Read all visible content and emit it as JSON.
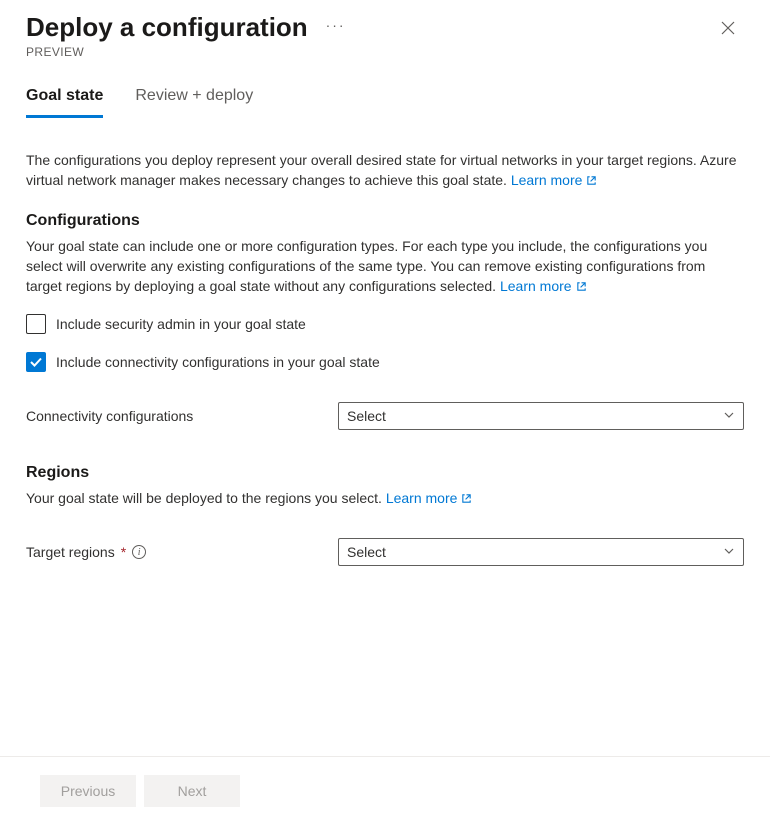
{
  "header": {
    "title": "Deploy a configuration",
    "subtitle": "PREVIEW"
  },
  "tabs": [
    {
      "label": "Goal state",
      "active": true
    },
    {
      "label": "Review + deploy",
      "active": false
    }
  ],
  "intro": {
    "text": "The configurations you deploy represent your overall desired state for virtual networks in your target regions. Azure virtual network manager makes necessary changes to achieve this goal state.",
    "learn_more": "Learn more"
  },
  "configurations": {
    "heading": "Configurations",
    "text": "Your goal state can include one or more configuration types. For each type you include, the configurations you select will overwrite any existing configurations of the same type. You can remove existing configurations from target regions by deploying a goal state without any configurations selected.",
    "learn_more": "Learn more",
    "include_security": {
      "checked": false,
      "label": "Include security admin in your goal state"
    },
    "include_connectivity": {
      "checked": true,
      "label": "Include connectivity configurations in your goal state"
    },
    "connectivity_select": {
      "label": "Connectivity configurations",
      "value": "Select"
    }
  },
  "regions": {
    "heading": "Regions",
    "text": "Your goal state will be deployed to the regions you select.",
    "learn_more": "Learn more",
    "target_select": {
      "label": "Target regions",
      "required": true,
      "value": "Select"
    }
  },
  "footer": {
    "previous": "Previous",
    "next": "Next"
  }
}
